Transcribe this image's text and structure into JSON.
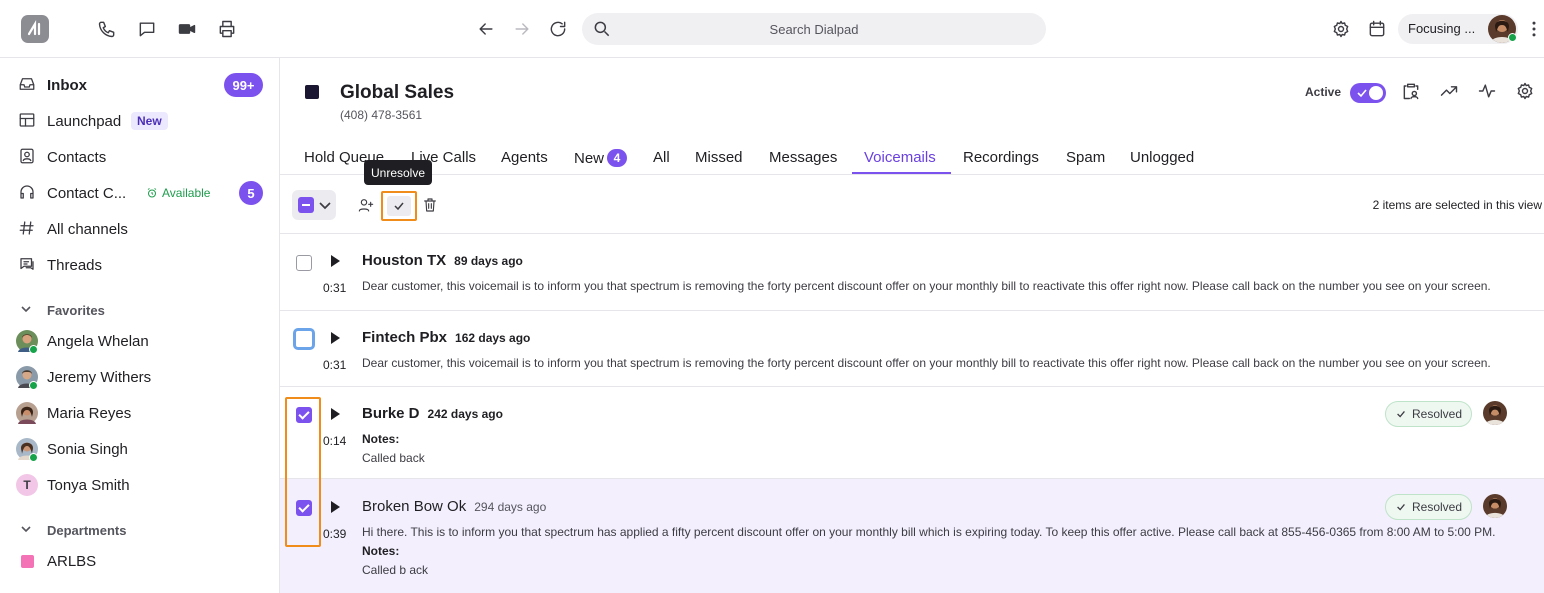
{
  "topbar": {
    "search_placeholder": "Search Dialpad",
    "status_label": "Focusing ..."
  },
  "sidebar": {
    "items": [
      {
        "label": "Inbox",
        "icon": "inbox-icon",
        "badge": "99+"
      },
      {
        "label": "Launchpad",
        "icon": "launchpad-icon",
        "tag": "New"
      },
      {
        "label": "Contacts",
        "icon": "contacts-icon"
      },
      {
        "label": "Contact C...",
        "icon": "headset-icon",
        "status": "Available",
        "badge": "5"
      },
      {
        "label": "All channels",
        "icon": "hash-icon"
      },
      {
        "label": "Threads",
        "icon": "threads-icon"
      }
    ],
    "favorites_title": "Favorites",
    "favorites": [
      {
        "name": "Angela Whelan"
      },
      {
        "name": "Jeremy Withers"
      },
      {
        "name": "Maria Reyes"
      },
      {
        "name": "Sonia Singh"
      },
      {
        "name": "Tonya Smith",
        "initial": "T"
      }
    ],
    "departments_title": "Departments",
    "departments": [
      {
        "name": "ARLBS",
        "color": "#f472b6"
      }
    ]
  },
  "header": {
    "title": "Global Sales",
    "phone": "(408) 478-3561",
    "active_label": "Active",
    "color": "#1a1530"
  },
  "tabs": [
    {
      "label": "Hold Queue"
    },
    {
      "label": "Live Calls"
    },
    {
      "label": "Agents"
    },
    {
      "label": "New",
      "badge": "4"
    },
    {
      "label": "All"
    },
    {
      "label": "Missed"
    },
    {
      "label": "Messages"
    },
    {
      "label": "Voicemails",
      "active": true
    },
    {
      "label": "Recordings"
    },
    {
      "label": "Spam"
    },
    {
      "label": "Unlogged"
    }
  ],
  "tooltip": "Unresolve",
  "toolbar": {
    "selected_count": "2 items are selected in this view"
  },
  "voicemails": [
    {
      "name": "Houston TX",
      "ago": "89 days ago",
      "duration": "0:31",
      "message": "Dear customer, this voicemail is to inform you that spectrum is removing the forty percent discount offer on your monthly bill to reactivate this offer right now. Please call back on the number you see on your screen.",
      "checked": false
    },
    {
      "name": "Fintech Pbx",
      "ago": "162 days ago",
      "duration": "0:31",
      "message": "Dear customer, this voicemail is to inform you that spectrum is removing the forty percent discount offer on your monthly bill to reactivate this offer right now. Please call back on the number you see on your screen.",
      "checked": false
    },
    {
      "name": "Burke D",
      "ago": "242 days ago",
      "duration": "0:14",
      "notes_label": "Notes:",
      "notes": "Called back",
      "status": "Resolved",
      "checked": true
    },
    {
      "name": "Broken Bow Ok",
      "ago": "294 days ago",
      "duration": "0:39",
      "message": "Hi there. This is to inform you that spectrum has applied a fifty percent discount offer on your monthly bill which is expiring today. To keep this offer active. Please call back at 855-456-0365 from 8:00 AM to 5:00 PM.",
      "notes_label": "Notes:",
      "notes": "Called b ack",
      "status": "Resolved",
      "checked": true
    }
  ],
  "colors": {
    "accent": "#7c52ee",
    "highlight_border": "#f08c1a",
    "resolved_bg": "#eef8f1"
  }
}
